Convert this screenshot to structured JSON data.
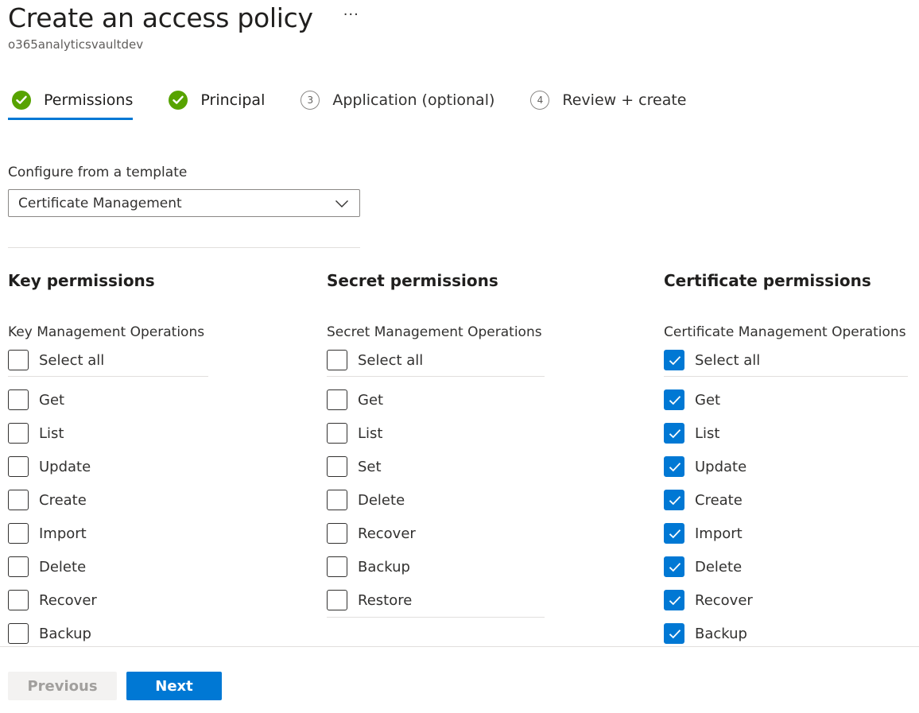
{
  "page": {
    "title": "Create an access policy",
    "subtitle": "o365analyticsvaultdev",
    "more_label": "···"
  },
  "steps": [
    {
      "label": "Permissions",
      "status": "complete",
      "active": true
    },
    {
      "label": "Principal",
      "status": "complete",
      "active": false
    },
    {
      "label": "Application (optional)",
      "status": "pending",
      "number": "3",
      "active": false
    },
    {
      "label": "Review + create",
      "status": "pending",
      "number": "4",
      "active": false
    }
  ],
  "template": {
    "label": "Configure from a template",
    "selected": "Certificate Management"
  },
  "columns": {
    "key": {
      "heading": "Key permissions",
      "subheading": "Key Management Operations",
      "select_all": {
        "label": "Select all",
        "checked": false
      },
      "items": [
        {
          "label": "Get",
          "checked": false
        },
        {
          "label": "List",
          "checked": false
        },
        {
          "label": "Update",
          "checked": false
        },
        {
          "label": "Create",
          "checked": false
        },
        {
          "label": "Import",
          "checked": false
        },
        {
          "label": "Delete",
          "checked": false
        },
        {
          "label": "Recover",
          "checked": false
        },
        {
          "label": "Backup",
          "checked": false
        }
      ]
    },
    "secret": {
      "heading": "Secret permissions",
      "subheading": "Secret Management Operations",
      "select_all": {
        "label": "Select all",
        "checked": false
      },
      "items": [
        {
          "label": "Get",
          "checked": false
        },
        {
          "label": "List",
          "checked": false
        },
        {
          "label": "Set",
          "checked": false
        },
        {
          "label": "Delete",
          "checked": false
        },
        {
          "label": "Recover",
          "checked": false
        },
        {
          "label": "Backup",
          "checked": false
        },
        {
          "label": "Restore",
          "checked": false
        }
      ]
    },
    "cert": {
      "heading": "Certificate permissions",
      "subheading": "Certificate Management Operations",
      "select_all": {
        "label": "Select all",
        "checked": true
      },
      "items": [
        {
          "label": "Get",
          "checked": true
        },
        {
          "label": "List",
          "checked": true
        },
        {
          "label": "Update",
          "checked": true
        },
        {
          "label": "Create",
          "checked": true
        },
        {
          "label": "Import",
          "checked": true
        },
        {
          "label": "Delete",
          "checked": true
        },
        {
          "label": "Recover",
          "checked": true
        },
        {
          "label": "Backup",
          "checked": true
        }
      ]
    }
  },
  "footer": {
    "previous_label": "Previous",
    "next_label": "Next"
  },
  "colors": {
    "accent": "#0078d4",
    "success": "#57a300",
    "divider": "#e1dfdd"
  }
}
